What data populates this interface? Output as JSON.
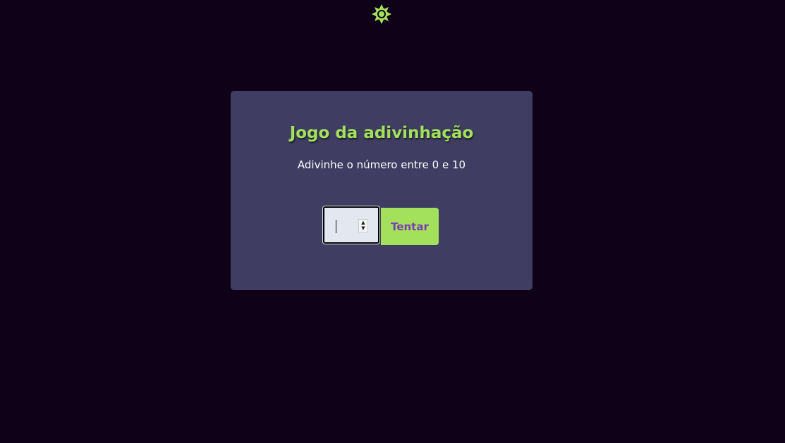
{
  "theme_toggle": {
    "icon": "sun-icon",
    "color": "#a3e05c"
  },
  "game": {
    "title": "Jogo da adivinhação",
    "subtitle": "Adivinhe o número entre 0 e 10",
    "input_value": "",
    "button_label": "Tentar"
  },
  "colors": {
    "background": "#0f0118",
    "card": "#3f3e62",
    "accent": "#a3e05c",
    "button_text": "#7b3bb5"
  }
}
